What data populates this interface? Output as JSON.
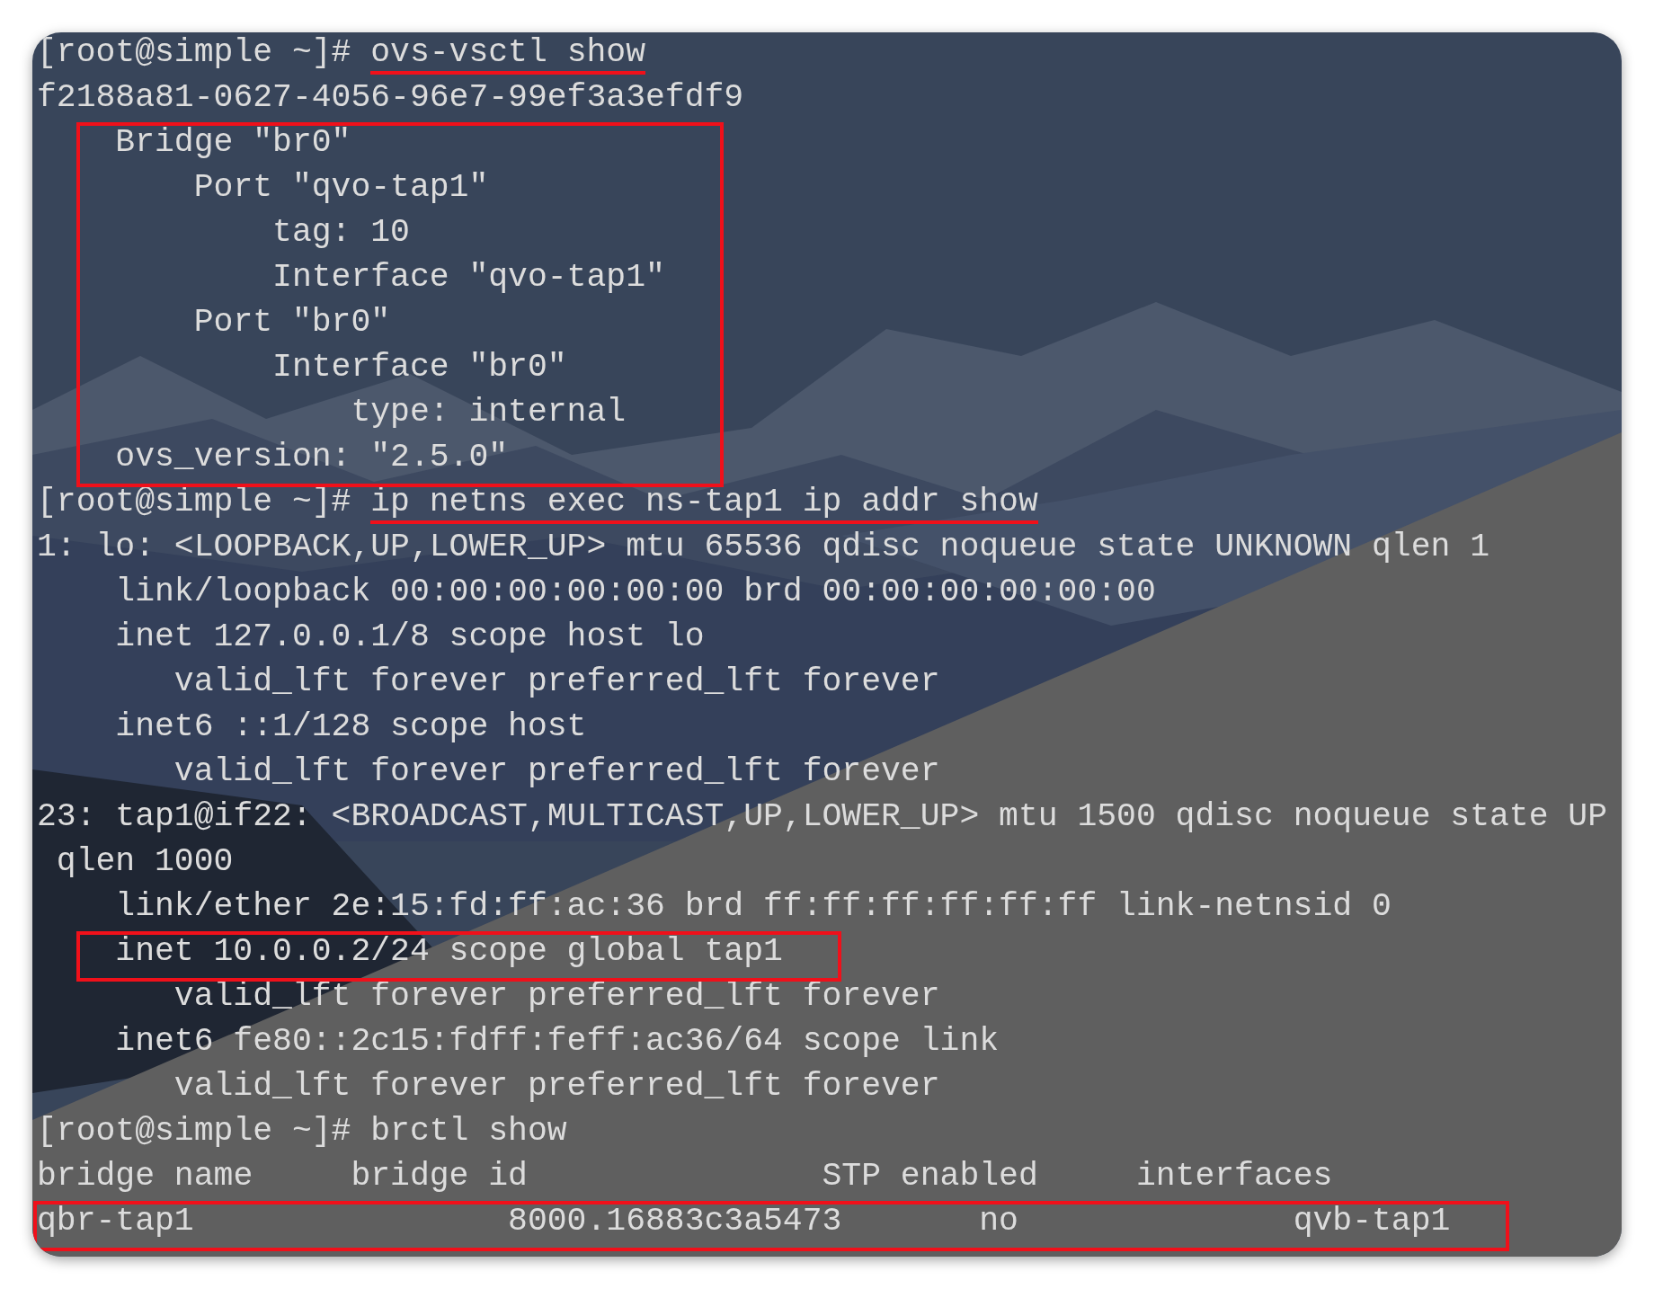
{
  "terminal": [
    {
      "kind": "prompt",
      "prompt": "[root@simple ~]# ",
      "command": "ovs-vsctl show",
      "underlined": true
    },
    {
      "kind": "output",
      "text": "f2188a81-0627-4056-96e7-99ef3a3efdf9"
    },
    {
      "kind": "group",
      "highlighted": true,
      "lines": [
        {
          "kind": "output",
          "text": "    Bridge \"br0\""
        },
        {
          "kind": "output",
          "text": "        Port \"qvo-tap1\""
        },
        {
          "kind": "output",
          "text": "            tag: 10"
        },
        {
          "kind": "output",
          "text": "            Interface \"qvo-tap1\""
        },
        {
          "kind": "output",
          "text": "        Port \"br0\""
        },
        {
          "kind": "output",
          "text": "            Interface \"br0\""
        },
        {
          "kind": "output",
          "text": "                type: internal"
        },
        {
          "kind": "output",
          "text": "    ovs_version: \"2.5.0\""
        }
      ]
    },
    {
      "kind": "prompt",
      "prompt": "[root@simple ~]# ",
      "command": "ip netns exec ns-tap1 ip addr show",
      "underlined": true
    },
    {
      "kind": "output",
      "text": "1: lo: <LOOPBACK,UP,LOWER_UP> mtu 65536 qdisc noqueue state UNKNOWN qlen 1"
    },
    {
      "kind": "output",
      "text": "    link/loopback 00:00:00:00:00:00 brd 00:00:00:00:00:00"
    },
    {
      "kind": "output",
      "text": "    inet 127.0.0.1/8 scope host lo"
    },
    {
      "kind": "output",
      "text": "       valid_lft forever preferred_lft forever"
    },
    {
      "kind": "output",
      "text": "    inet6 ::1/128 scope host"
    },
    {
      "kind": "output",
      "text": "       valid_lft forever preferred_lft forever"
    },
    {
      "kind": "output",
      "text": "23: tap1@if22: <BROADCAST,MULTICAST,UP,LOWER_UP> mtu 1500 qdisc noqueue state UP"
    },
    {
      "kind": "output",
      "text": " qlen 1000"
    },
    {
      "kind": "output",
      "text": "    link/ether 2e:15:fd:ff:ac:36 brd ff:ff:ff:ff:ff:ff link-netnsid 0"
    },
    {
      "kind": "group",
      "highlighted": true,
      "lines": [
        {
          "kind": "output",
          "text": "    inet 10.0.0.2/24 scope global tap1"
        }
      ]
    },
    {
      "kind": "output",
      "text": "       valid_lft forever preferred_lft forever"
    },
    {
      "kind": "output",
      "text": "    inet6 fe80::2c15:fdff:feff:ac36/64 scope link"
    },
    {
      "kind": "output",
      "text": "       valid_lft forever preferred_lft forever"
    },
    {
      "kind": "prompt",
      "prompt": "[root@simple ~]# ",
      "command": "brctl show",
      "underlined": false
    },
    {
      "kind": "output",
      "text": "bridge name     bridge id               STP enabled     interfaces"
    },
    {
      "kind": "group",
      "highlighted": true,
      "lines": [
        {
          "kind": "output",
          "text": "qbr-tap1                8000.16883c3a5473       no              qvb-tap1"
        }
      ]
    }
  ]
}
